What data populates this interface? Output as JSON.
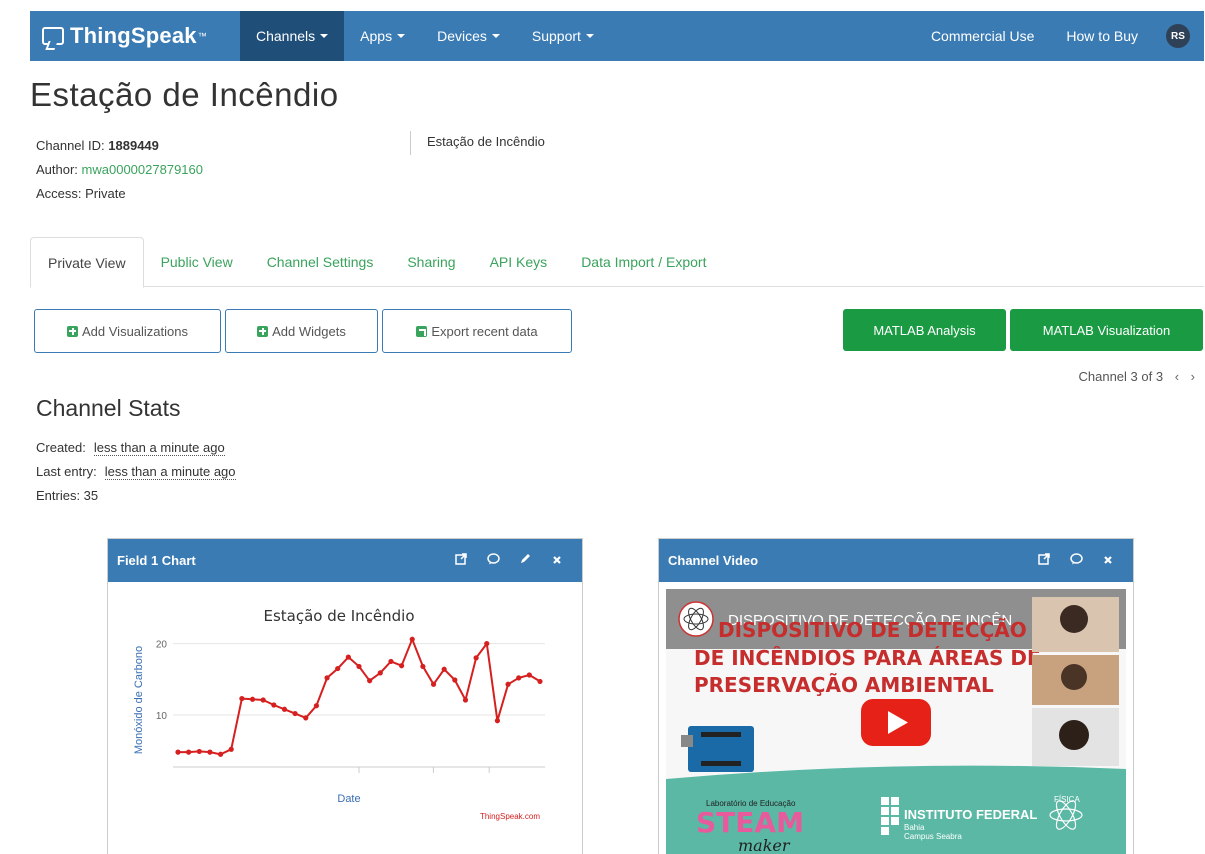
{
  "navbar": {
    "brand": "ThingSpeak",
    "brand_tm": "™",
    "items": [
      {
        "label": "Channels"
      },
      {
        "label": "Apps"
      },
      {
        "label": "Devices"
      },
      {
        "label": "Support"
      }
    ],
    "right": [
      "Commercial Use",
      "How to Buy"
    ],
    "avatar": "RS"
  },
  "channel": {
    "title": "Estação de Incêndio",
    "id_label": "Channel ID:",
    "id": "1889449",
    "author_label": "Author:",
    "author": "mwa0000027879160",
    "access": "Access: Private",
    "description": "Estação de Incêndio"
  },
  "tabs": [
    "Private View",
    "Public View",
    "Channel Settings",
    "Sharing",
    "API Keys",
    "Data Import / Export"
  ],
  "buttons": {
    "add_visualizations": "Add Visualizations",
    "add_widgets": "Add Widgets",
    "export": "Export recent data",
    "matlab_analysis": "MATLAB Analysis",
    "matlab_visualization": "MATLAB Visualization"
  },
  "channel_nav": {
    "text": "Channel 3 of 3",
    "prev": "‹",
    "next": "›"
  },
  "stats": {
    "title": "Channel Stats",
    "created_label": "Created:",
    "created": "less than a minute ago",
    "last_entry_label": "Last entry:",
    "last_entry": "less than a minute ago",
    "entries": "Entries: 35"
  },
  "field_chart": {
    "header": "Field 1 Chart",
    "credit": "ThingSpeak.com"
  },
  "video": {
    "header": "Channel Video",
    "video_title": "DISPOSITIVO DE DETECÇÃO DE INCÊN...",
    "headline_lines": [
      "DISPOSITIVO DE DETECÇÃO",
      "DE INCÊNDIOS PARA ÁREAS DE",
      "PRESERVAÇÃO AMBIENTAL"
    ],
    "steam_label": "Laboratório de Educação",
    "steam": "STEAM",
    "maker": "maker",
    "if_name": "INSTITUTO FEDERAL",
    "if_sub1": "Bahia",
    "if_sub2": "Campus Seabra",
    "fisica": "FÍSICA"
  },
  "colors": {
    "navbar": "#3a7bb4",
    "navbar_active": "#1f4e79",
    "green": "#3aa35d",
    "matlab_green": "#1a9b43",
    "chart_line": "#d62020",
    "axis_blue": "#3a6fb4"
  },
  "chart_data": {
    "type": "line",
    "title": "Estação de Incêndio",
    "xlabel": "Date",
    "ylabel": "Monóxido de Carbono",
    "yticks": [
      10,
      20
    ],
    "ylim": [
      3,
      24
    ],
    "grid": true,
    "series": [
      {
        "values": [
          4.8,
          4.8,
          4.9,
          4.8,
          4.5,
          5.2,
          12.3,
          12.2,
          12.1,
          11.4,
          10.8,
          10.2,
          9.6,
          11.3,
          15.2,
          16.5,
          18.1,
          16.8,
          14.8,
          15.9,
          17.5,
          16.9,
          20.6,
          16.8,
          14.3,
          16.4,
          14.9,
          12.1,
          18.0,
          20.0,
          9.2,
          14.3,
          15.2,
          15.6,
          14.7
        ]
      }
    ]
  }
}
